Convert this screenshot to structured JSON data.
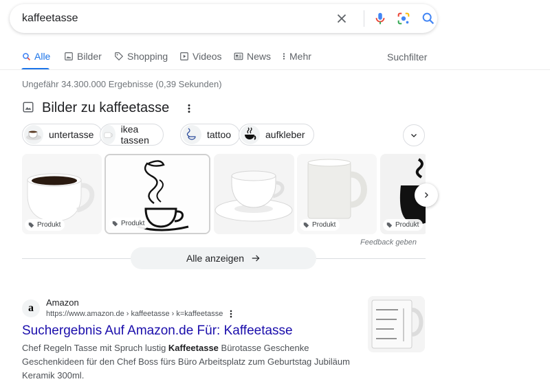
{
  "search": {
    "query": "kaffeetasse"
  },
  "tabs": {
    "items": [
      {
        "label": "Alle"
      },
      {
        "label": "Bilder"
      },
      {
        "label": "Shopping"
      },
      {
        "label": "Videos"
      },
      {
        "label": "News"
      },
      {
        "label": "Mehr"
      }
    ],
    "active_index": 0,
    "tools_label": "Suchfilter"
  },
  "result_stats": "Ungefähr 34.300.000 Ergebnisse (0,39 Sekunden)",
  "images_block": {
    "title": "Bilder zu kaffeetasse",
    "chips": [
      {
        "label": "untertasse"
      },
      {
        "label": "ikea tassen"
      },
      {
        "label": "tattoo"
      },
      {
        "label": "aufkleber"
      }
    ],
    "images": [
      {
        "badge": "Produkt"
      },
      {
        "badge": "Produkt"
      },
      {
        "badge": ""
      },
      {
        "badge": "Produkt"
      },
      {
        "badge": "Produkt"
      }
    ],
    "feedback": "Feedback geben",
    "show_all": "Alle anzeigen"
  },
  "result": {
    "site_name": "Amazon",
    "favicon_letter": "a",
    "url": "https://www.amazon.de › kaffeetasse › k=kaffeetasse",
    "title": "Suchergebnis Auf Amazon.de Für: Kaffeetasse",
    "snippet_before": "Chef Regeln Tasse mit Spruch lustig ",
    "snippet_bold": "Kaffeetasse",
    "snippet_after": " Bürotasse Geschenke Geschenkideen für den Chef Boss fürs Büro Arbeitsplatz zum Geburtstag Jubiläum Keramik 300ml."
  },
  "colors": {
    "accent": "#1a73e8",
    "link": "#1a0dab",
    "text": "#202124",
    "muted": "#70757a"
  }
}
